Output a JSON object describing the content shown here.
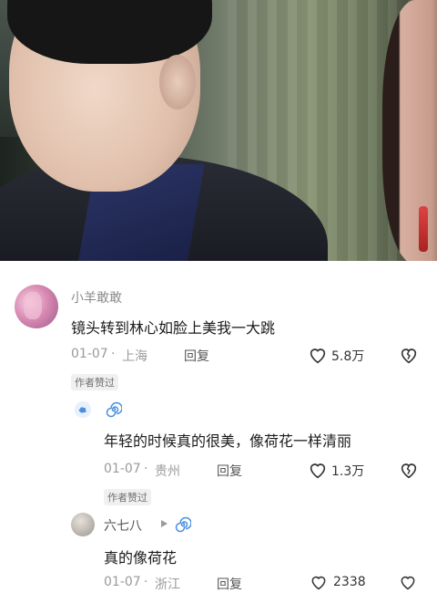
{
  "comments": [
    {
      "username": "小羊敢敢",
      "text": "镜头转到林心如脸上美我一大跳",
      "date": "01-07",
      "location": "上海",
      "reply_label": "回复",
      "likes": "5.8万",
      "badge": "作者赞过"
    },
    {
      "text": "年轻的时候真的很美，像荷花一样清丽",
      "date": "01-07",
      "location": "贵州",
      "reply_label": "回复",
      "likes": "1.3万",
      "badge": "作者赞过"
    },
    {
      "username": "六七八",
      "text": "真的像荷花",
      "date": "01-07",
      "location": "浙江",
      "reply_label": "回复",
      "likes": "2338"
    }
  ],
  "icons": [
    "heart-icon",
    "broken-heart-icon",
    "play-arrow-icon",
    "spiral-badge-icon",
    "like-bubble-icon"
  ],
  "colors": {
    "accent_blue": "#4a8fe0",
    "text_gray": "#9a9a9a"
  }
}
